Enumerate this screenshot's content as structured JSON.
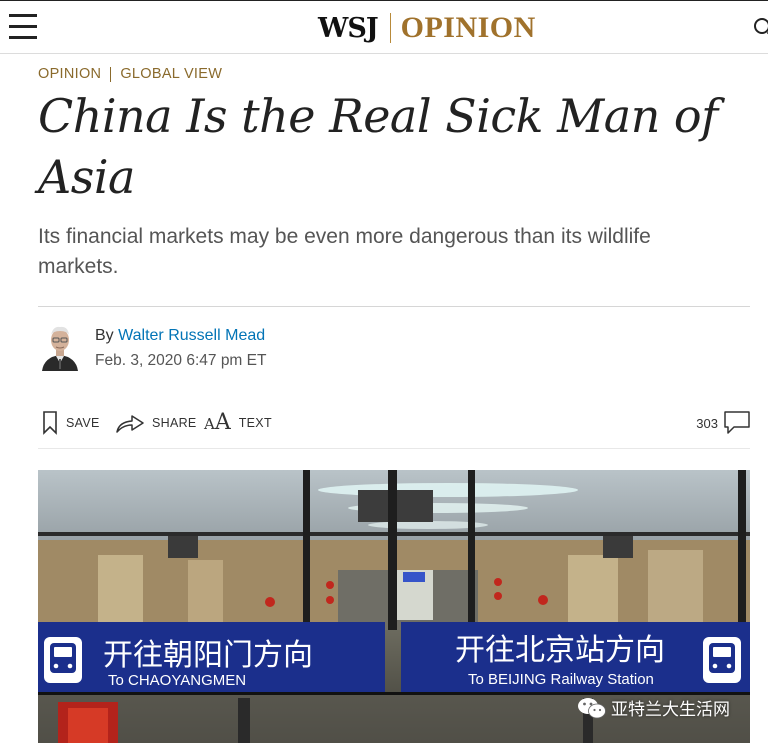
{
  "header": {
    "brand_wsj": "WSJ",
    "brand_section": "OPINION",
    "icons": {
      "menu": "hamburger-menu-icon",
      "search": "search-icon"
    }
  },
  "article": {
    "breadcrumb": {
      "section": "OPINION",
      "column": "GLOBAL VIEW"
    },
    "headline": "China Is the Real Sick Man of Asia",
    "dek": "Its financial markets may be even more dangerous than its wildlife markets.",
    "byline_prefix": "By ",
    "author": "Walter Russell Mead",
    "date": "Feb. 3, 2020 6:47 pm ET"
  },
  "toolbar": {
    "save_label": "SAVE",
    "share_label": "SHARE",
    "text_label": "TEXT",
    "comment_count": "303",
    "icons": {
      "save": "bookmark-icon",
      "share": "share-arrow-icon",
      "text": "text-size-icon",
      "comments": "comment-bubble-icon"
    }
  },
  "photo": {
    "sign_left_zh": "开往朝阳门方向",
    "sign_left_en": "To CHAOYANGMEN",
    "sign_right_zh": "开往北京站方向",
    "sign_right_en": "To BEIJING Railway Station",
    "sign_icon": "subway-train-icon"
  },
  "watermark": {
    "text": "亚特兰大生活网",
    "icon": "wechat-icon"
  },
  "colors": {
    "brand_gold": "#a0722c",
    "link_blue": "#0274b6",
    "sign_blue": "#1b2f8c",
    "headline": "#222222"
  }
}
